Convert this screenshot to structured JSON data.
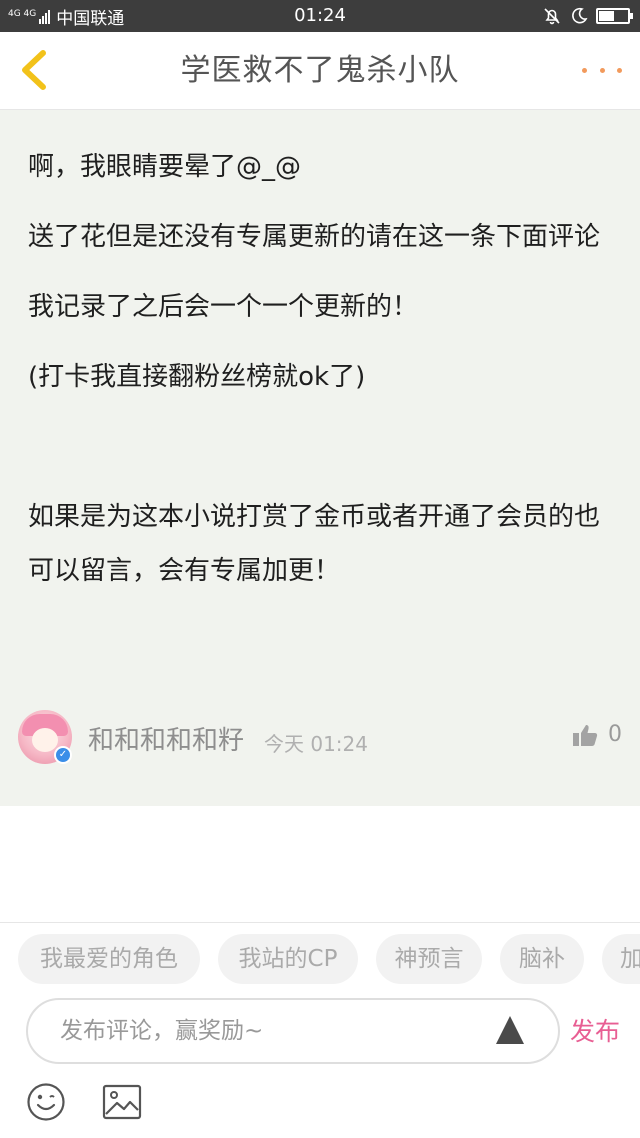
{
  "status_bar": {
    "network": "4G 4G",
    "carrier": "中国联通",
    "time": "01:24",
    "battery_level": 0.55
  },
  "header": {
    "title": "学医救不了鬼杀小队",
    "back_icon": "chevron-left-icon",
    "more_icon": "more-dots-icon"
  },
  "post": {
    "paragraphs": [
      "啊，我眼睛要晕了@_@",
      "送了花但是还没有专属更新的请在这一条下面评论",
      "我记录了之后会一个一个更新的！",
      "(打卡我直接翻粉丝榜就ok了)",
      "",
      "如果是为这本小说打赏了金币或者开通了会员的也可以留言，会有专属加更！"
    ],
    "author": "和和和和和籽",
    "time": "今天 01:24",
    "likes": "0"
  },
  "tags": [
    "我最爱的角色",
    "我站的CP",
    "神预言",
    "脑补",
    "加"
  ],
  "comment": {
    "placeholder": "发布评论，赢奖励~",
    "publish_label": "发布"
  },
  "colors": {
    "accent_pink": "#e85e93",
    "more_orange": "#f29a5c",
    "back_yellow": "#f2c21a",
    "content_bg": "#f1f3ee"
  }
}
